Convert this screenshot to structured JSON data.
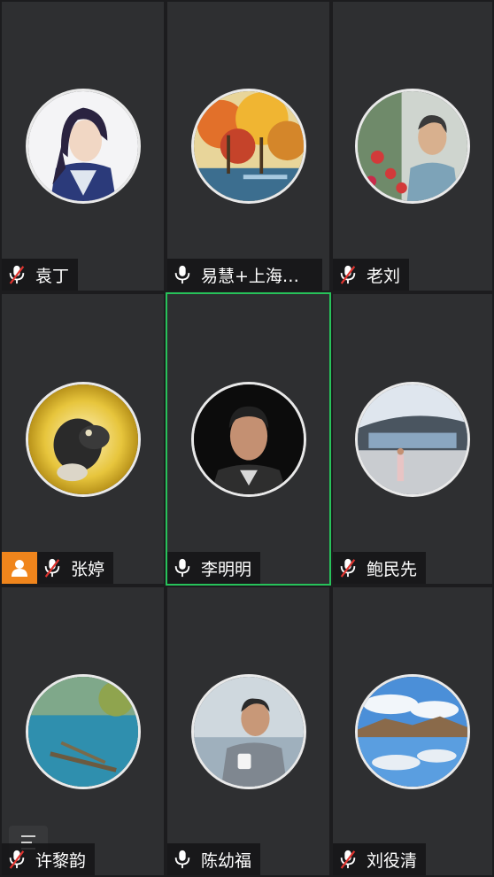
{
  "participants": [
    {
      "name": "袁丁",
      "muted": true,
      "host": false,
      "active": false,
      "avatar_icon": "anime-swordsman-icon"
    },
    {
      "name": "易慧+上海音…",
      "muted": false,
      "host": false,
      "active": false,
      "avatar_icon": "autumn-painting-icon"
    },
    {
      "name": "老刘",
      "muted": true,
      "host": false,
      "active": false,
      "avatar_icon": "elderly-man-flowers-icon"
    },
    {
      "name": "张婷",
      "muted": true,
      "host": true,
      "active": false,
      "avatar_icon": "monkey-icon"
    },
    {
      "name": "李明明",
      "muted": false,
      "host": false,
      "active": true,
      "avatar_icon": "man-portrait-icon"
    },
    {
      "name": "鲍民先",
      "muted": true,
      "host": false,
      "active": false,
      "avatar_icon": "building-person-icon"
    },
    {
      "name": "许黎韵",
      "muted": true,
      "host": false,
      "active": false,
      "avatar_icon": "lake-tree-icon"
    },
    {
      "name": "陈幼福",
      "muted": false,
      "host": false,
      "active": false,
      "avatar_icon": "man-with-cup-icon"
    },
    {
      "name": "刘役清",
      "muted": true,
      "host": false,
      "active": false,
      "avatar_icon": "mountain-lake-icon"
    }
  ],
  "colors": {
    "active_border": "#27c25a",
    "host_badge": "#f0851c",
    "muted_slash": "#e0342f",
    "tile_bg": "#2e2f31"
  }
}
